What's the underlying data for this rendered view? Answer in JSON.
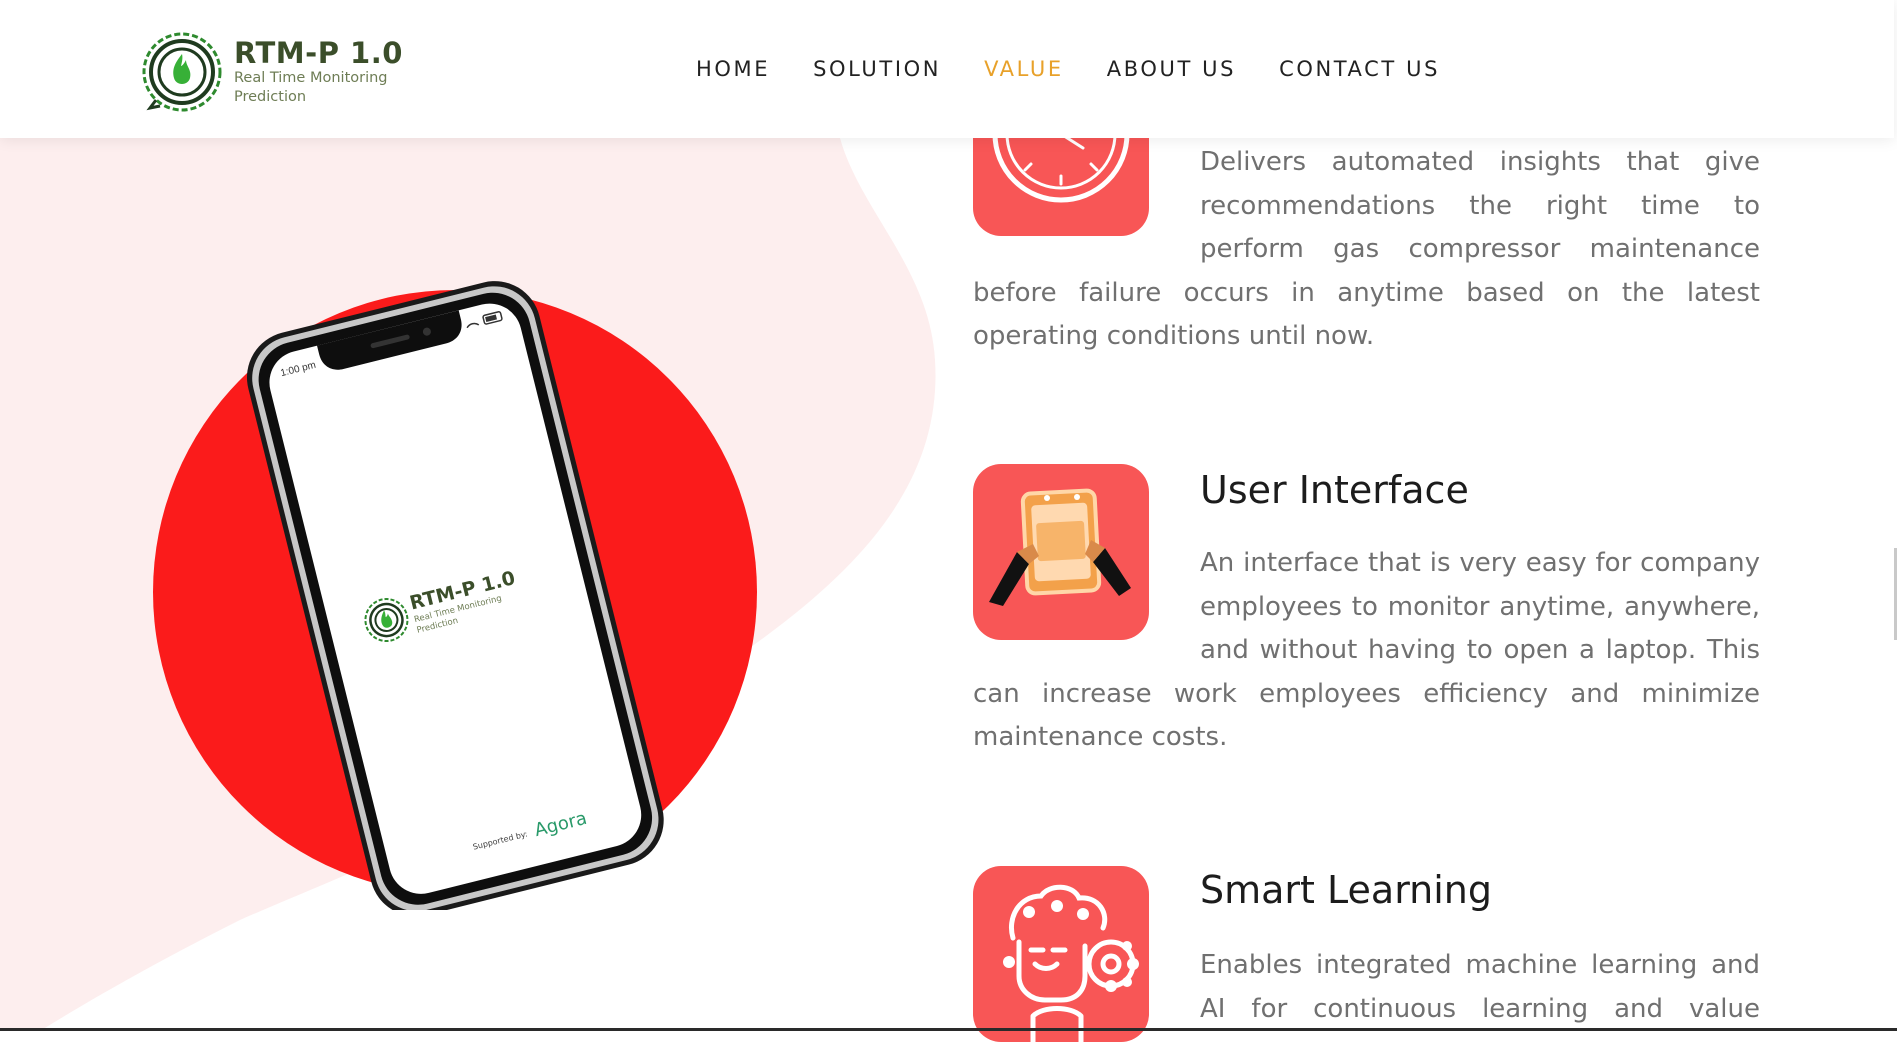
{
  "brand": {
    "title": "RTM-P 1.0",
    "subtitle_line1": "Real Time Monitoring",
    "subtitle_line2": "Prediction"
  },
  "nav": {
    "items": [
      {
        "label": "HOME"
      },
      {
        "label": "SOLUTION"
      },
      {
        "label": "VALUE"
      },
      {
        "label": "ABOUT US"
      },
      {
        "label": "CONTACT US"
      }
    ],
    "active_index": 2
  },
  "phone": {
    "time": "1:00 pm",
    "app_title": "RTM-P 1.0",
    "app_sub1": "Real Time Monitoring",
    "app_sub2": "Prediction",
    "supported_by": "Supported by:",
    "sponsor": "Agora"
  },
  "features": [
    {
      "icon": "clock-icon",
      "lines": [
        "Delivers automated insights that give",
        "recommendations the right time to",
        "perform gas compressor maintenance",
        "before failure occurs in anytime based on the latest",
        "operating conditions until now."
      ]
    },
    {
      "icon": "user-interface-icon",
      "title": "User Interface",
      "lines": [
        "An interface that is very easy for company",
        "employees to monitor anytime, anywhere,",
        "and without having to open a laptop. This",
        "can increase work employees efficiency and minimize",
        "maintenance costs."
      ]
    },
    {
      "icon": "smart-learning-brain-icon",
      "title": "Smart Learning",
      "lines": [
        "Enables integrated machine learning and",
        "AI for continuous learning and value"
      ]
    }
  ],
  "colors": {
    "accent": "#e8a12a",
    "icon_bg": "#f85656",
    "circle_red": "#fb1b1b",
    "blob_pink": "#fdeeee",
    "logo_green": "#2e8a2e"
  }
}
